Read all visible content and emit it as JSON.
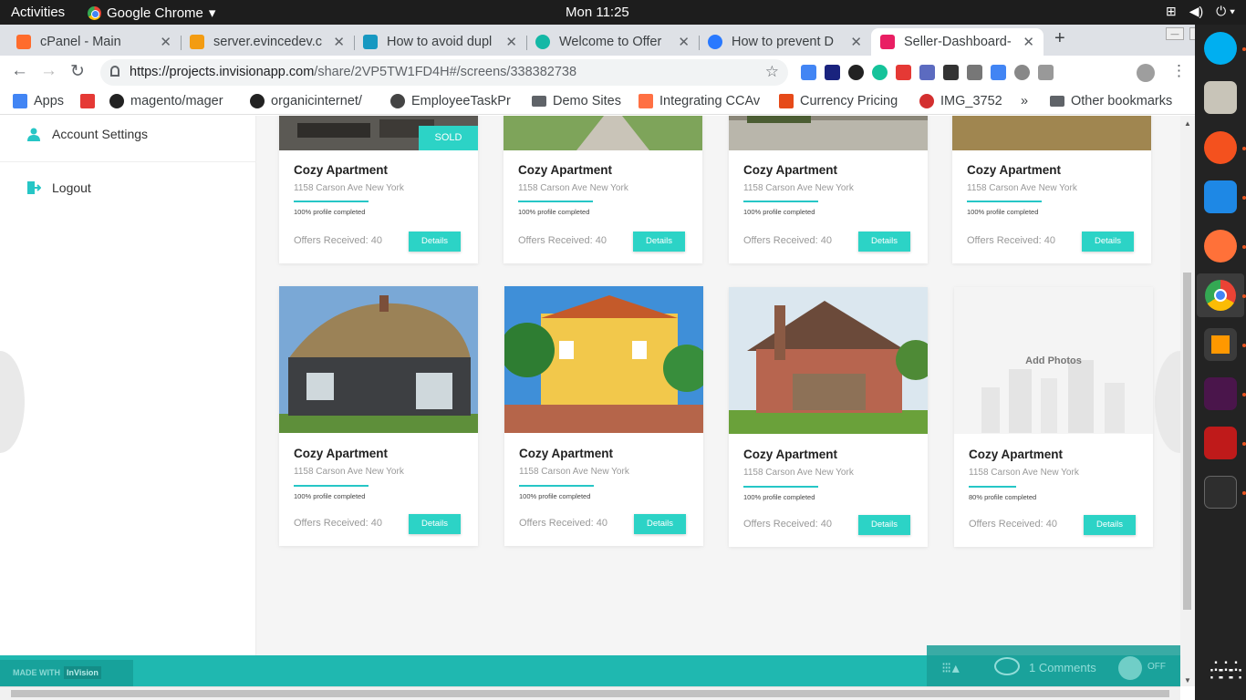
{
  "system": {
    "activities": "Activities",
    "app_name": "Google Chrome",
    "clock": "Mon 11:25"
  },
  "browser": {
    "tabs": [
      {
        "title": "cPanel - Main",
        "color": "#ff6c2c"
      },
      {
        "title": "server.evincedev.c",
        "color": "#f39c12"
      },
      {
        "title": "How to avoid dupl",
        "color": "#1798c1"
      },
      {
        "title": "Welcome to Offer",
        "color": "#14b8a6"
      },
      {
        "title": "How to prevent D",
        "color": "#2979ff"
      },
      {
        "title": "Seller-Dashboard-",
        "color": "#e91e63"
      }
    ],
    "url_domain": "https://projects.invisionapp.com",
    "url_path": "/share/2VP5TW1FD4H#/screens/338382738",
    "bookmarks": [
      {
        "label": "Apps",
        "color": "#4285f4"
      },
      {
        "label": "",
        "color": "#e53935"
      },
      {
        "label": "magento/mager",
        "color": "#222222"
      },
      {
        "label": "organicinternet/",
        "color": "#222222"
      },
      {
        "label": "EmployeeTaskPr",
        "color": "#444444"
      },
      {
        "label": "Demo Sites",
        "color": "#5f6368"
      },
      {
        "label": "Integrating CCAv",
        "color": "#ff7043"
      },
      {
        "label": "Currency Pricing",
        "color": "#e64a19"
      },
      {
        "label": "IMG_3752",
        "color": "#d32f2f"
      },
      {
        "label": "»",
        "color": ""
      },
      {
        "label": "Other bookmarks",
        "color": "#5f6368"
      }
    ]
  },
  "sidebar": {
    "items": [
      {
        "label": "Account Settings"
      },
      {
        "label": "Logout"
      }
    ]
  },
  "listings": [
    {
      "name": "Cozy Apartment",
      "address": "1158 Carson Ave New York",
      "progress": "100% profile completed",
      "offers": "Offers Received: 40",
      "details": "Details",
      "badge": "SOLD"
    },
    {
      "name": "Cozy Apartment",
      "address": "1158 Carson Ave New York",
      "progress": "100% profile completed",
      "offers": "Offers Received: 40",
      "details": "Details"
    },
    {
      "name": "Cozy Apartment",
      "address": "1158 Carson Ave New York",
      "progress": "100% profile completed",
      "offers": "Offers Received: 40",
      "details": "Details"
    },
    {
      "name": "Cozy Apartment",
      "address": "1158 Carson Ave New York",
      "progress": "100% profile completed",
      "offers": "Offers Received: 40",
      "details": "Details"
    },
    {
      "name": "Cozy Apartment",
      "address": "1158 Carson Ave New York",
      "progress": "100% profile completed",
      "offers": "Offers Received: 40",
      "details": "Details"
    },
    {
      "name": "Cozy Apartment",
      "address": "1158 Carson Ave New York",
      "progress": "100% profile completed",
      "offers": "Offers Received: 40",
      "details": "Details"
    },
    {
      "name": "Cozy Apartment",
      "address": "1158 Carson Ave New York",
      "progress": "100% profile completed",
      "offers": "Offers Received: 40",
      "details": "Details"
    },
    {
      "name": "Cozy Apartment",
      "address": "1158 Carson Ave New York",
      "progress": "80% profile completed",
      "offers": "Offers Received: 40",
      "details": "Details",
      "placeholder": "Add Photos"
    }
  ],
  "invision": {
    "made_with": "MADE WITH",
    "brand": "InVision",
    "comments": "1 Comments",
    "toggle": "OFF"
  },
  "colors": {
    "accent": "#2cd3c6",
    "footer": "#1fb8b0"
  }
}
